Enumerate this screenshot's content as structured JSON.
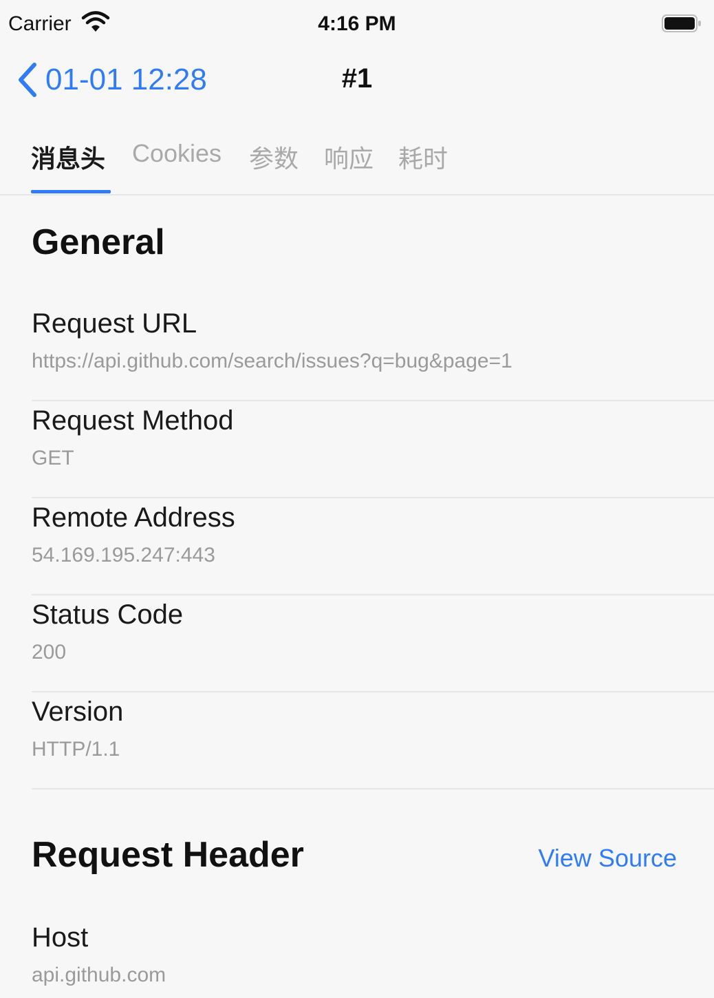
{
  "status_bar": {
    "carrier": "Carrier",
    "time": "4:16 PM",
    "wifi_icon": "wifi-icon",
    "battery_icon": "battery-icon"
  },
  "nav": {
    "back_label": "01-01 12:28",
    "back_icon": "chevron-left-icon",
    "title": "#1",
    "accent_color": "#2f7cf6"
  },
  "tabs": [
    {
      "label": "消息头",
      "active": true
    },
    {
      "label": "Cookies",
      "active": false
    },
    {
      "label": "参数",
      "active": false
    },
    {
      "label": "响应",
      "active": false
    },
    {
      "label": "耗时",
      "active": false
    }
  ],
  "general": {
    "title": "General",
    "rows": [
      {
        "label": "Request URL",
        "value": "https://api.github.com/search/issues?q=bug&page=1"
      },
      {
        "label": "Request Method",
        "value": "GET"
      },
      {
        "label": "Remote Address",
        "value": "54.169.195.247:443"
      },
      {
        "label": "Status Code",
        "value": "200"
      },
      {
        "label": "Version",
        "value": "HTTP/1.1"
      }
    ]
  },
  "request_header": {
    "title": "Request Header",
    "view_source_label": "View Source",
    "rows": [
      {
        "label": "Host",
        "value": "api.github.com"
      }
    ]
  }
}
